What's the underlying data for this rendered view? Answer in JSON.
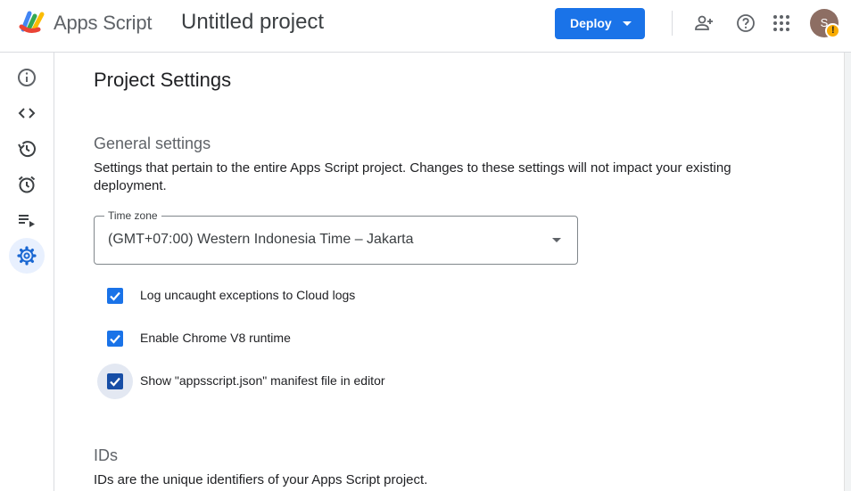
{
  "header": {
    "app_name": "Apps Script",
    "project_title": "Untitled project",
    "deploy_label": "Deploy",
    "icons": [
      "add-person-icon",
      "help-icon",
      "apps-grid-icon"
    ],
    "avatar_initial": "S",
    "avatar_warning": "!"
  },
  "sidebar": {
    "items": [
      {
        "name": "overview",
        "icon": "info-icon"
      },
      {
        "name": "editor",
        "icon": "code-icon"
      },
      {
        "name": "history",
        "icon": "history-icon"
      },
      {
        "name": "triggers",
        "icon": "alarm-icon"
      },
      {
        "name": "executions",
        "icon": "executions-list-icon"
      },
      {
        "name": "settings",
        "icon": "gear-icon",
        "active": true
      }
    ]
  },
  "main": {
    "page_title": "Project Settings",
    "general": {
      "title": "General settings",
      "description": "Settings that pertain to the entire Apps Script project. Changes to these settings will not impact your existing deployment.",
      "timezone_label": "Time zone",
      "timezone_value": "(GMT+07:00) Western Indonesia Time – Jakarta",
      "checkboxes": [
        {
          "label": "Log uncaught exceptions to Cloud logs",
          "checked": true
        },
        {
          "label": "Enable Chrome V8 runtime",
          "checked": true
        },
        {
          "label": "Show \"appsscript.json\" manifest file in editor",
          "checked": true
        }
      ]
    },
    "ids": {
      "title": "IDs",
      "description": "IDs are the unique identifiers of your Apps Script project."
    }
  },
  "colors": {
    "accent": "#1a73e8",
    "checkbox_focused": "#174ea6",
    "sidebar_active_bg": "#e8f0fe",
    "avatar_bg": "#8d6e63",
    "warning": "#f9ab00"
  }
}
